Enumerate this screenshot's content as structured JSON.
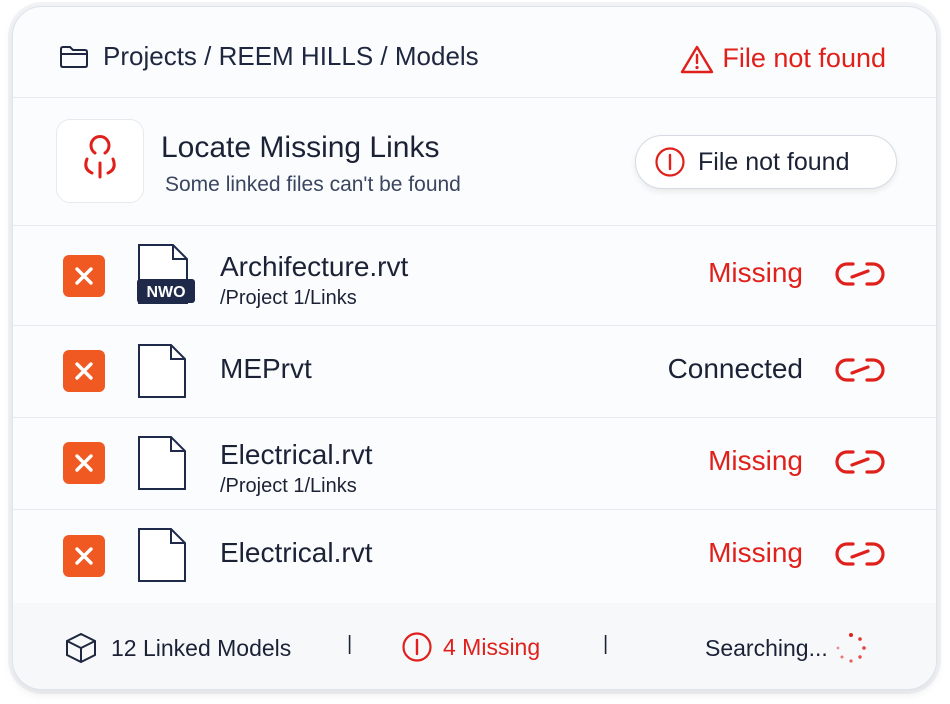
{
  "breadcrumb": {
    "text": "Projects / REEM HILLS / Models"
  },
  "top_status": {
    "label": "File not found"
  },
  "header": {
    "title": "Locate Missing Links",
    "subtitle": "Some linked files can't be found",
    "pill_label": "File not found"
  },
  "rows": [
    {
      "name": "Archifecture.rvt",
      "path": "/Project 1/Links",
      "status": "Missing",
      "badge": "NWO"
    },
    {
      "name": "MEPrvt",
      "path": "",
      "status": "Connected",
      "badge": ""
    },
    {
      "name": "Electrical.rvt",
      "path": "/Project 1/Links",
      "status": "Missing",
      "badge": ""
    },
    {
      "name": "Electrical.rvt",
      "path": "",
      "status": "Missing",
      "badge": ""
    }
  ],
  "footer": {
    "linked_models": "12 Linked Models",
    "missing": "4 Missing",
    "searching": "Searching...",
    "separator": "|"
  },
  "colors": {
    "accent_red": "#e0201b",
    "x_orange": "#f05a22",
    "navy": "#1f2a4a"
  },
  "icons": {
    "breadcrumb": "folder-icon",
    "top_status": "warning-triangle-icon",
    "header": "broken-link-icon",
    "pill": "alert-circle-icon",
    "row_remove": "close-icon",
    "row_file": "file-icon",
    "row_link": "broken-link-icon",
    "footer_models": "cube-icon",
    "footer_missing": "alert-circle-icon",
    "footer_searching": "spinner-icon"
  }
}
